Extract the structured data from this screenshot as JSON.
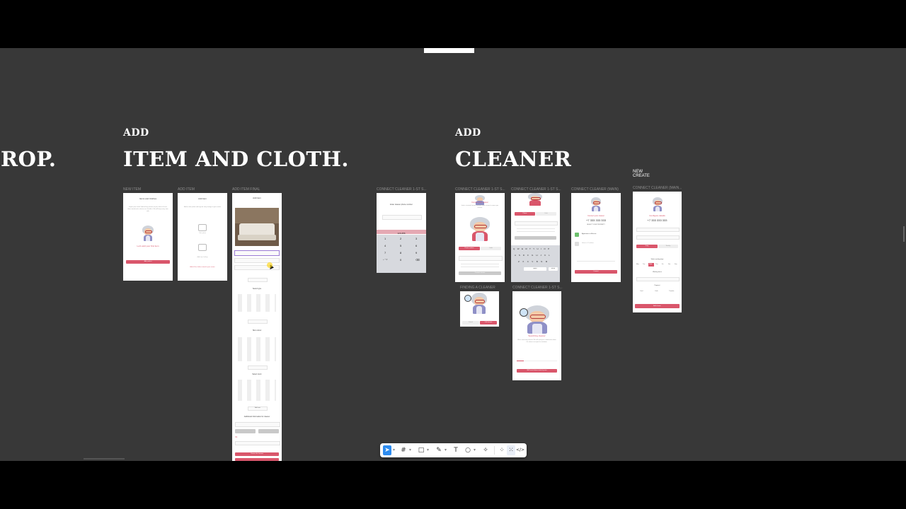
{
  "sections": {
    "prev_title": "ROP.",
    "item_add": "ADD",
    "item_title": "ITEM AND CLOTH.",
    "cleaner_add": "ADD",
    "cleaner_title": "CLEANER",
    "new_create": "NEW\nCREATE"
  },
  "frames": {
    "new_item": {
      "label": "NEW ITEM",
      "title": "Items and Clothes",
      "body": "Import your closet! Upload any pictures of your items to have them stored and a cleaner can handle it. We will keep every item safe.",
      "cta_text": "Let's add your first item",
      "button": "Add product"
    },
    "add_item": {
      "label": "ADD ITEM",
      "title": "Add item",
      "body": "Add an item photo and tags for easy storage in your rooms",
      "hint1": "Take photo",
      "hint2": "Add from Gallery",
      "link": "Add all the clothes stored in your rooms"
    },
    "add_item_final": {
      "label": "ADD ITEM FINAL",
      "title": "Add item",
      "select_type": "Select type",
      "skin_colour": "Skin colour",
      "select_room": "Select room",
      "add_new": "Add new",
      "extra": "Additional information for cleaner",
      "ok": "Ok",
      "button": "Choose the cleaners"
    },
    "connect_1": {
      "label": "CONNECT CLEANER 1-ST S...",
      "prompt": "Enter cleaner phone number",
      "keys": [
        "1",
        "2",
        "3",
        "4",
        "5",
        "6",
        "7",
        "8",
        "9",
        "0"
      ],
      "sub": "+ * #",
      "value": "123-456"
    },
    "connect_2": {
      "label": "CONNECT CLEANER 1-ST S...",
      "title": "Connect your cleaner",
      "body": "Invite a trusted cleaner and give them access to rooms you choose.",
      "tab_a": "Phone number",
      "tab_b": "Code",
      "button": "Connect cleaner"
    },
    "connect_3": {
      "label": "CONNECT CLEANER 1-ST S...",
      "tab_a": "Phone",
      "tab_b": "Code",
      "rows": [
        "Q W E R T Y U I O P",
        "A S D F G H J K L",
        "Z X C V B N M"
      ],
      "space": "space",
      "return": "return"
    },
    "connect_main": {
      "label": "CONNECT CLEANER (MAIN)",
      "title": "Connect your cleaner",
      "phone": "+7 333 333 333",
      "select": "SELECT YOUR PROPERTY",
      "prop1": "Appartment in Moscow",
      "prop2": "House in Pushkino",
      "button": "Connect"
    },
    "configure": {
      "label": "CONNECT CLEANER (MAIN...",
      "title": "Configure details",
      "phone": "+7 333 333 333",
      "seg_a": "Daily",
      "seg_b": "Weekly",
      "days_label": "Select working days",
      "days": [
        "Mon",
        "Tue",
        "Wed",
        "Thu",
        "Fri",
        "Sat",
        "Sun"
      ],
      "hours_label": "Working hours",
      "payment": "Payment",
      "pay_opts": [
        "Card",
        "Cash",
        "Transfer"
      ],
      "button": "Add cleaner"
    },
    "finding": {
      "label": "FINDING A CLEANER",
      "btn_a": "Cancel",
      "btn_b": "Call cleaner"
    },
    "connect_4": {
      "label": "CONNECT CLEANER 1-ST S...",
      "title": "Searching cleaner",
      "body": "We're searching cleaner. We will send you a notification when the cleaner accepts the invitation.",
      "button": "We'll send cleaner invite by sms"
    }
  },
  "toolbar": {
    "select_icon": "cursor-icon",
    "frame_icon": "grid-icon",
    "shape_icon": "square-icon",
    "pen_icon": "pen-icon",
    "text_icon": "T",
    "comment_icon": "comment-icon",
    "ai_icon": "sparkle-icon",
    "mode_icon": "mode-icon",
    "dev_icon": "</>"
  },
  "colors": {
    "canvas": "#383838",
    "accent": "#d9566b",
    "select": "#2d8cf0"
  }
}
